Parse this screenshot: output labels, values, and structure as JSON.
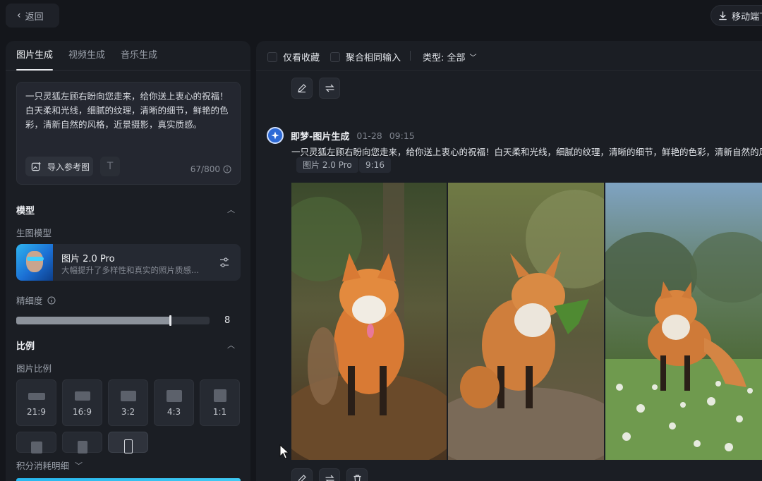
{
  "topbar": {
    "back_label": "返回",
    "mobile_label": "移动端下"
  },
  "left": {
    "tabs": [
      {
        "label": "图片生成",
        "active": true
      },
      {
        "label": "视频生成",
        "active": false
      },
      {
        "label": "音乐生成",
        "active": false
      }
    ],
    "prompt": {
      "text": "一只灵狐左顾右盼向您走来，给你送上衷心的祝福！白天柔和光线，细腻的纹理，清晰的细节，鲜艳的色彩，清新自然的风格，近景摄影，真实质感。",
      "ref_button": "导入参考图",
      "text_tool_icon": "T",
      "char_count": "67/800"
    },
    "model_section": {
      "title": "模型",
      "sub_label": "生图模型",
      "model_name": "图片 2.0 Pro",
      "model_desc": "大幅提升了多样性和真实的照片质感..."
    },
    "detail": {
      "label": "精细度",
      "value": "8",
      "fill_fraction": 0.8
    },
    "ratio_section": {
      "title": "比例",
      "sub_label": "图片比例",
      "options": [
        "21:9",
        "16:9",
        "3:2",
        "4:3",
        "1:1"
      ]
    },
    "points_label": "积分消耗明细"
  },
  "right": {
    "filters": {
      "favorites_only": "仅看收藏",
      "merge_same": "聚合相同输入",
      "type_label": "类型: 全部"
    },
    "generation": {
      "source": "即梦-图片生成",
      "date": "01-28",
      "time": "09:15",
      "prompt": "一只灵狐左顾右盼向您走来，给你送上衷心的祝福！白天柔和光线，细腻的纹理，清晰的细节，鲜艳的色彩，清新自然的风",
      "model_tag": "图片 2.0 Pro",
      "ratio_tag": "9:16"
    }
  },
  "colors": {
    "accent": "#2fb4f0",
    "panel": "#1b1e24",
    "background": "#14161b"
  }
}
